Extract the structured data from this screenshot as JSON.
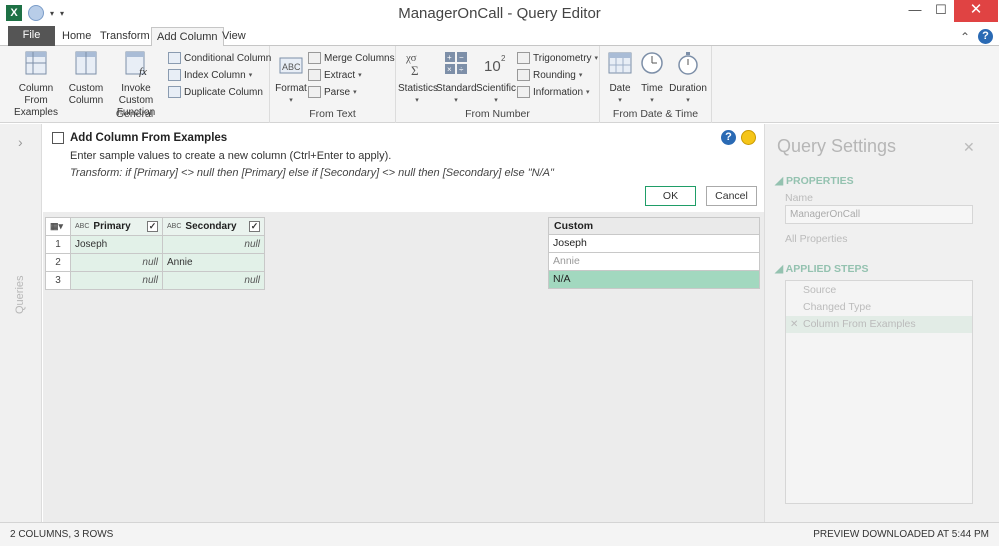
{
  "window": {
    "title": "ManagerOnCall - Query Editor",
    "minimize": "—",
    "maximize": "☐",
    "close": "✕"
  },
  "ribbon_tabs": [
    "File",
    "Home",
    "Transform",
    "Add Column",
    "View"
  ],
  "ribbon_right": {
    "collapse": "⌃",
    "help": "?"
  },
  "ribbon": {
    "general": {
      "label": "General",
      "column_from_examples": "Column From\nExamples",
      "custom_column": "Custom\nColumn",
      "invoke_custom_function": "Invoke Custom\nFunction",
      "conditional_column": "Conditional Column",
      "index_column": "Index Column",
      "duplicate_column": "Duplicate Column"
    },
    "from_text": {
      "label": "From Text",
      "format": "Format",
      "merge_columns": "Merge Columns",
      "extract": "Extract",
      "parse": "Parse"
    },
    "from_number": {
      "label": "From Number",
      "statistics": "Statistics",
      "standard": "Standard",
      "scientific": "Scientific",
      "trigonometry": "Trigonometry",
      "rounding": "Rounding",
      "information": "Information"
    },
    "from_date_time": {
      "label": "From Date & Time",
      "date": "Date",
      "time": "Time",
      "duration": "Duration"
    }
  },
  "left_pane": {
    "label": "Queries"
  },
  "examples_panel": {
    "title": "Add Column From Examples",
    "subtitle": "Enter sample values to create a new column (Ctrl+Enter to apply).",
    "transform": "Transform: if [Primary] <> null then [Primary] else if [Secondary] <> null then [Secondary] else \"N/A\"",
    "ok_label": "OK",
    "cancel_label": "Cancel"
  },
  "grid": {
    "columns": [
      "Primary",
      "Secondary"
    ],
    "rows": [
      {
        "num": "1",
        "primary": "Joseph",
        "secondary": "null"
      },
      {
        "num": "2",
        "primary": "null",
        "secondary": "Annie"
      },
      {
        "num": "3",
        "primary": "null",
        "secondary": "null"
      }
    ]
  },
  "custom_column": {
    "header": "Custom",
    "values": [
      "Joseph",
      "Annie",
      "N/A"
    ]
  },
  "query_settings": {
    "title": "Query Settings",
    "properties_label": "PROPERTIES",
    "name_label": "Name",
    "name_value": "ManagerOnCall",
    "all_properties": "All Properties",
    "applied_steps_label": "APPLIED STEPS",
    "steps": [
      "Source",
      "Changed Type",
      "Column From Examples"
    ]
  },
  "status": {
    "left": "2 COLUMNS, 3 ROWS",
    "right": "PREVIEW DOWNLOADED AT 5:44 PM"
  }
}
